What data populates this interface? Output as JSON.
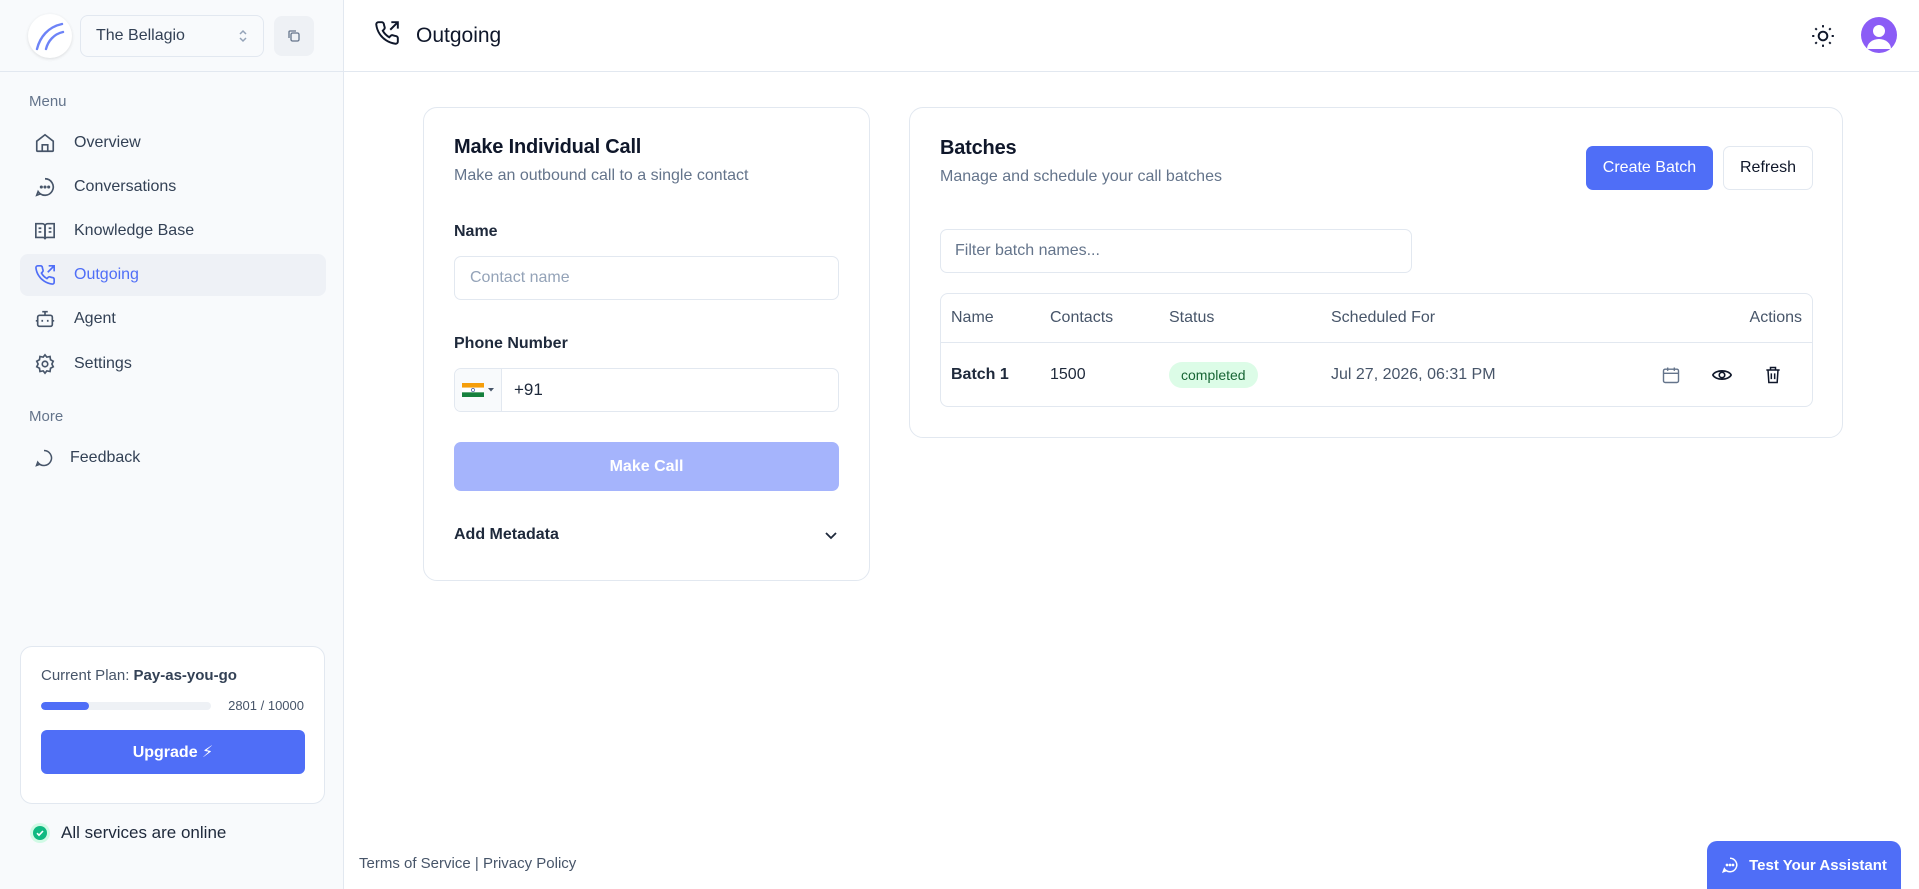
{
  "sidebar": {
    "org_name": "The Bellagio",
    "menu_label": "Menu",
    "more_label": "More",
    "items": [
      {
        "label": "Overview"
      },
      {
        "label": "Conversations"
      },
      {
        "label": "Knowledge Base"
      },
      {
        "label": "Outgoing"
      },
      {
        "label": "Agent"
      },
      {
        "label": "Settings"
      }
    ],
    "more_items": [
      {
        "label": "Feedback"
      }
    ],
    "plan": {
      "prefix": "Current Plan: ",
      "name": "Pay-as-you-go",
      "usage_text": "2801 / 10000",
      "usage_used": 2801,
      "usage_total": 10000,
      "upgrade_label": "Upgrade ⚡"
    },
    "status_text": "All services are online"
  },
  "header": {
    "title": "Outgoing"
  },
  "individual_call": {
    "title": "Make Individual Call",
    "subtitle": "Make an outbound call to a single contact",
    "name_label": "Name",
    "name_placeholder": "Contact name",
    "phone_label": "Phone Number",
    "phone_value": "+91",
    "make_call_label": "Make Call",
    "metadata_label": "Add Metadata"
  },
  "batches": {
    "title": "Batches",
    "subtitle": "Manage and schedule your call batches",
    "create_label": "Create Batch",
    "refresh_label": "Refresh",
    "filter_placeholder": "Filter batch names...",
    "columns": [
      "Name",
      "Contacts",
      "Status",
      "Scheduled For",
      "Actions"
    ],
    "rows": [
      {
        "name": "Batch 1",
        "contacts": "1500",
        "status": "completed",
        "scheduled": "Jul 27, 2026, 06:31 PM"
      }
    ]
  },
  "footer": {
    "terms": "Terms of Service",
    "separator": "|",
    "privacy": "Privacy Policy"
  },
  "assistant_button": "Test Your Assistant",
  "colors": {
    "accent": "#4f6ef7",
    "accent_disabled": "#a5b4fc",
    "success_bg": "#dcfce7",
    "success_text": "#166534"
  }
}
